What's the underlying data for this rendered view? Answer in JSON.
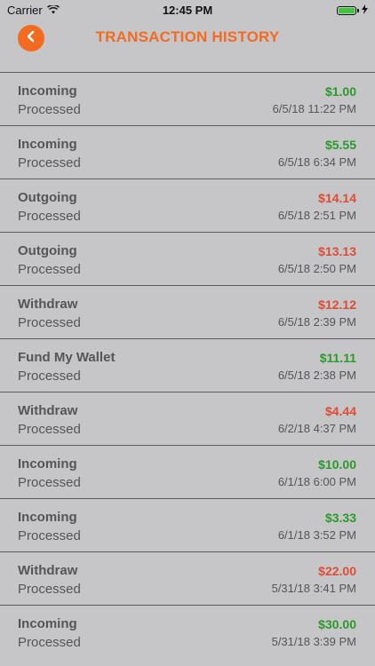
{
  "status_bar": {
    "carrier": "Carrier",
    "time": "12:45 PM"
  },
  "header": {
    "title": "TRANSACTION HISTORY"
  },
  "colors": {
    "accent": "#f36b21",
    "positive": "#2a9a2a",
    "negative": "#df4b33"
  },
  "transactions": [
    {
      "type": "Incoming",
      "status": "Processed",
      "amount": "$1.00",
      "date": "6/5/18 11:22 PM",
      "sign": "pos"
    },
    {
      "type": "Incoming",
      "status": "Processed",
      "amount": "$5.55",
      "date": "6/5/18 6:34 PM",
      "sign": "pos"
    },
    {
      "type": "Outgoing",
      "status": "Processed",
      "amount": "$14.14",
      "date": "6/5/18 2:51 PM",
      "sign": "neg"
    },
    {
      "type": "Outgoing",
      "status": "Processed",
      "amount": "$13.13",
      "date": "6/5/18 2:50 PM",
      "sign": "neg"
    },
    {
      "type": "Withdraw",
      "status": "Processed",
      "amount": "$12.12",
      "date": "6/5/18 2:39 PM",
      "sign": "neg"
    },
    {
      "type": "Fund My Wallet",
      "status": "Processed",
      "amount": "$11.11",
      "date": "6/5/18 2:38 PM",
      "sign": "pos"
    },
    {
      "type": "Withdraw",
      "status": "Processed",
      "amount": "$4.44",
      "date": "6/2/18 4:37 PM",
      "sign": "neg"
    },
    {
      "type": "Incoming",
      "status": "Processed",
      "amount": "$10.00",
      "date": "6/1/18 6:00 PM",
      "sign": "pos"
    },
    {
      "type": "Incoming",
      "status": "Processed",
      "amount": "$3.33",
      "date": "6/1/18 3:52 PM",
      "sign": "pos"
    },
    {
      "type": "Withdraw",
      "status": "Processed",
      "amount": "$22.00",
      "date": "5/31/18 3:41 PM",
      "sign": "neg"
    },
    {
      "type": "Incoming",
      "status": "Processed",
      "amount": "$30.00",
      "date": "5/31/18 3:39 PM",
      "sign": "pos"
    }
  ]
}
